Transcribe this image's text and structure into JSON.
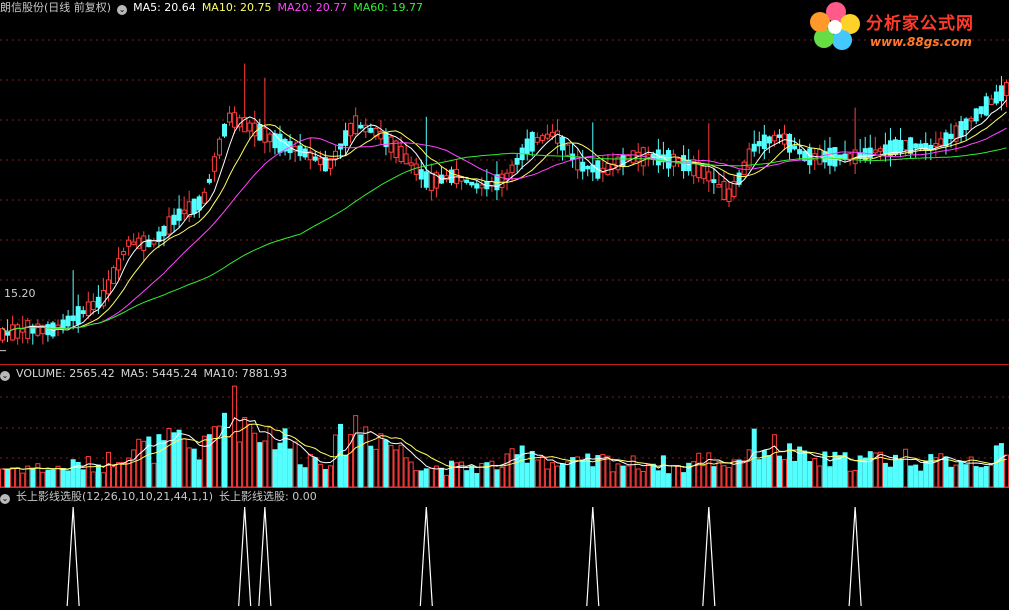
{
  "main_panel": {
    "stock_title": "朗信股份(日线 前复权)",
    "ma_labels": [
      {
        "text": "MA5: 20.64",
        "color": "#ffffff"
      },
      {
        "text": "MA10: 20.75",
        "color": "#ffff66"
      },
      {
        "text": "MA20: 20.77",
        "color": "#ff44ff"
      },
      {
        "text": "MA60: 19.77",
        "color": "#33ee33"
      }
    ],
    "low_price_label": "15.20"
  },
  "volume_panel": {
    "labels": [
      {
        "text": "VOLUME: 2565.42",
        "color": "#d8d8d8"
      },
      {
        "text": "MA5: 5445.24",
        "color": "#d8d8d8"
      },
      {
        "text": "MA10: 7881.93",
        "color": "#d8d8d8"
      }
    ]
  },
  "indicator_panel": {
    "name": "长上影线选股(12,26,10,10,21,44,1,1)",
    "value_label": "长上影线选股: 0.00"
  },
  "logo": {
    "text": "分析家公式网",
    "url": "www.88gs.com"
  },
  "colors": {
    "up": "#ff3c3c",
    "down": "#54ffff",
    "ma5": "#ffffff",
    "ma10": "#ffff66",
    "ma20": "#ff44ff",
    "ma60": "#33ee33",
    "grid": "#7a1e1e",
    "separator": "#c01a1a"
  },
  "chart_data": {
    "type": "candlestick",
    "ylim": [
      15.0,
      22.0
    ],
    "y_marker": 15.2,
    "ohlc_anchors": [
      [
        15.6,
        15.5
      ],
      [
        15.7,
        15.6
      ],
      [
        15.8,
        15.5
      ],
      [
        16.0,
        15.9
      ],
      [
        16.2,
        16.4
      ],
      [
        17.2,
        17.8
      ],
      [
        17.6,
        17.4
      ],
      [
        18.3,
        17.9
      ],
      [
        18.2,
        18.6
      ],
      [
        19.8,
        20.6
      ],
      [
        20.4,
        19.5
      ],
      [
        19.6,
        19.7
      ],
      [
        19.8,
        19.1
      ],
      [
        19.0,
        19.3
      ],
      [
        19.8,
        20.3
      ],
      [
        20.2,
        19.5
      ],
      [
        19.3,
        19.4
      ],
      [
        19.0,
        18.6
      ],
      [
        19.0,
        18.9
      ],
      [
        18.6,
        18.8
      ],
      [
        18.8,
        18.9
      ],
      [
        19.4,
        19.9
      ],
      [
        20.2,
        19.5
      ],
      [
        19.4,
        18.9
      ],
      [
        19.0,
        19.1
      ],
      [
        19.2,
        19.5
      ],
      [
        19.5,
        19.2
      ],
      [
        19.3,
        19.2
      ],
      [
        19.4,
        18.6
      ],
      [
        18.4,
        18.6
      ],
      [
        19.3,
        19.9
      ],
      [
        20.2,
        19.4
      ],
      [
        19.2,
        19.5
      ],
      [
        19.5,
        19.2
      ],
      [
        19.4,
        19.3
      ],
      [
        19.2,
        19.8
      ],
      [
        19.7,
        19.5
      ],
      [
        19.3,
        19.8
      ],
      [
        19.8,
        19.9
      ],
      [
        20.4,
        20.3
      ],
      [
        20.5,
        21.1
      ]
    ],
    "volume_anchors": [
      3000,
      3200,
      2800,
      3500,
      3600,
      6500,
      6000,
      7200,
      5600,
      13000,
      9500,
      8200,
      4800,
      4600,
      10000,
      8600,
      5200,
      3200,
      3000,
      3200,
      3600,
      6200,
      3600,
      3600,
      4200,
      3600,
      3900,
      3000,
      4700,
      3700,
      6800,
      6100,
      4200,
      4100,
      4100,
      4600,
      4800,
      3700,
      4600,
      4300,
      5200
    ],
    "vol_ylim": [
      0,
      17000
    ],
    "signal_days": [
      14,
      48,
      52,
      84,
      117,
      140,
      169
    ]
  }
}
